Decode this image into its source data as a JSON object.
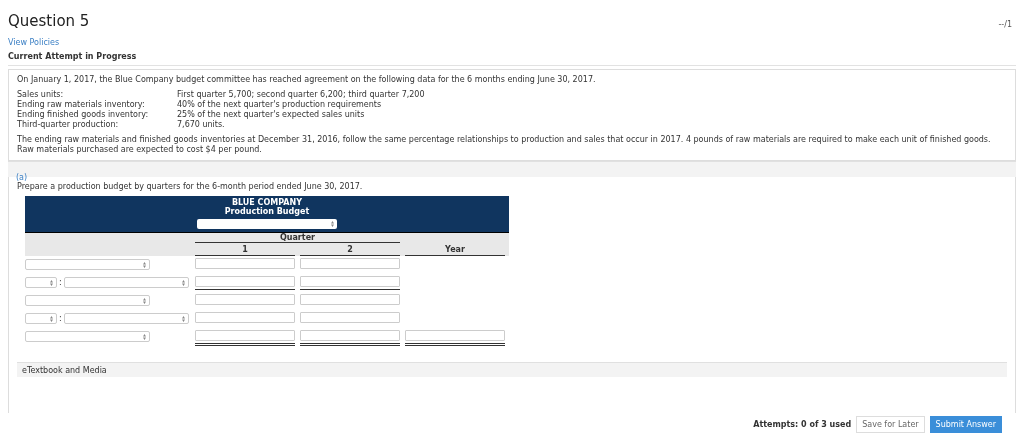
{
  "question": {
    "title": "Question 5",
    "score": "--/1",
    "policies_link": "View Policies",
    "attempt_status": "Current Attempt in Progress"
  },
  "problem": {
    "intro": "On January 1, 2017, the Blue Company budget committee has reached agreement on the following data for the 6 months ending June 30, 2017.",
    "facts": [
      {
        "label": "Sales units:",
        "value": "First quarter 5,700; second quarter 6,200; third quarter 7,200"
      },
      {
        "label": "Ending raw materials inventory:",
        "value": "40% of the next quarter's production requirements"
      },
      {
        "label": "Ending finished goods inventory:",
        "value": "25% of the next quarter's expected sales units"
      },
      {
        "label": "Third-quarter production:",
        "value": "7,670 units."
      }
    ],
    "note": "The ending raw materials and finished goods inventories at December 31, 2016, follow the same percentage relationships to production and sales that occur in 2017. 4 pounds of raw materials are required to make each unit of finished goods. Raw materials purchased are expected to cost $4 per pound."
  },
  "part": {
    "label": "(a)",
    "instruction": "Prepare a production budget by quarters for the 6-month period ended June 30, 2017.",
    "budget": {
      "company": "BLUE COMPANY",
      "title": "Production Budget",
      "group_heading": "Quarter",
      "columns": [
        "1",
        "2"
      ],
      "year_heading": "Year",
      "rows": [
        {
          "kind": "single",
          "underlined": false,
          "double_underlined": false,
          "year_field": false
        },
        {
          "kind": "split",
          "separator": ":",
          "underlined": true,
          "double_underlined": false,
          "year_field": false
        },
        {
          "kind": "single",
          "underlined": false,
          "double_underlined": false,
          "year_field": false
        },
        {
          "kind": "split",
          "separator": ":",
          "underlined": false,
          "double_underlined": false,
          "year_field": false
        },
        {
          "kind": "single",
          "underlined": true,
          "double_underlined": true,
          "year_field": true
        }
      ]
    }
  },
  "resources": {
    "label": "eTextbook and Media"
  },
  "footer": {
    "attempts": "Attempts: 0 of 3 used",
    "buttons": [
      {
        "label": "Save for Later",
        "kind": "secondary"
      },
      {
        "label": "Submit Answer",
        "kind": "primary"
      }
    ]
  }
}
